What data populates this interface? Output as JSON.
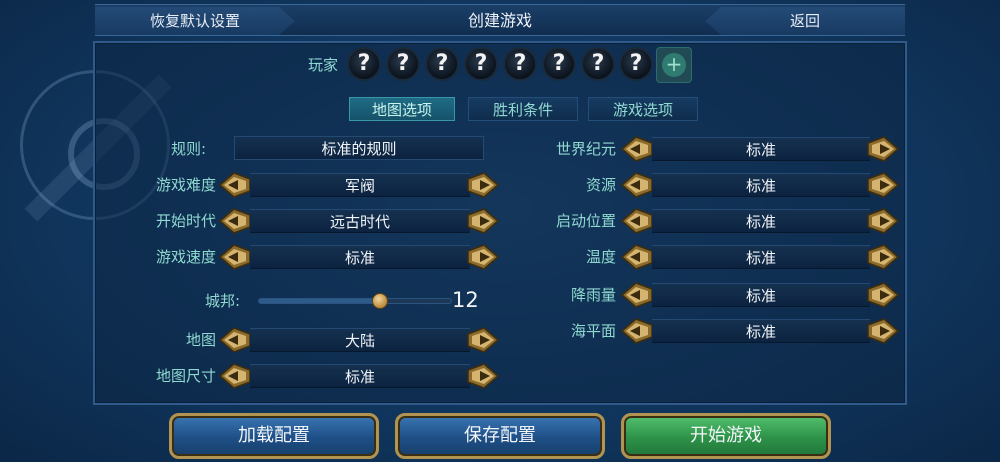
{
  "header": {
    "reset_label": "恢复默认设置",
    "title": "创建游戏",
    "back_label": "返回"
  },
  "players": {
    "label": "玩家",
    "slots": [
      "?",
      "?",
      "?",
      "?",
      "?",
      "?",
      "?",
      "?"
    ],
    "add_label": "+"
  },
  "tabs": [
    {
      "label": "地图选项",
      "active": true
    },
    {
      "label": "胜利条件",
      "active": false
    },
    {
      "label": "游戏选项",
      "active": false
    }
  ],
  "left_settings": {
    "rules": {
      "label": "规则:",
      "value": "标准的规则"
    },
    "difficulty": {
      "label": "游戏难度",
      "value": "军阀"
    },
    "start_era": {
      "label": "开始时代",
      "value": "远古时代"
    },
    "speed": {
      "label": "游戏速度",
      "value": "标准"
    },
    "city_states": {
      "label": "城邦:",
      "value": "12",
      "fraction": 0.63
    },
    "map": {
      "label": "地图",
      "value": "大陆"
    },
    "map_size": {
      "label": "地图尺寸",
      "value": "标准"
    }
  },
  "right_settings": [
    {
      "label": "世界纪元",
      "value": "标准"
    },
    {
      "label": "资源",
      "value": "标准"
    },
    {
      "label": "启动位置",
      "value": "标准"
    },
    {
      "label": "温度",
      "value": "标准"
    },
    {
      "label": "降雨量",
      "value": "标准"
    },
    {
      "label": "海平面",
      "value": "标准"
    }
  ],
  "buttons": {
    "load_config": "加载配置",
    "save_config": "保存配置",
    "start_game": "开始游戏"
  },
  "colors": {
    "accent_text": "#8fd9d0",
    "panel_blue": "#123a64",
    "gold_border": "#b0944f",
    "start_green": "#2d9248"
  }
}
